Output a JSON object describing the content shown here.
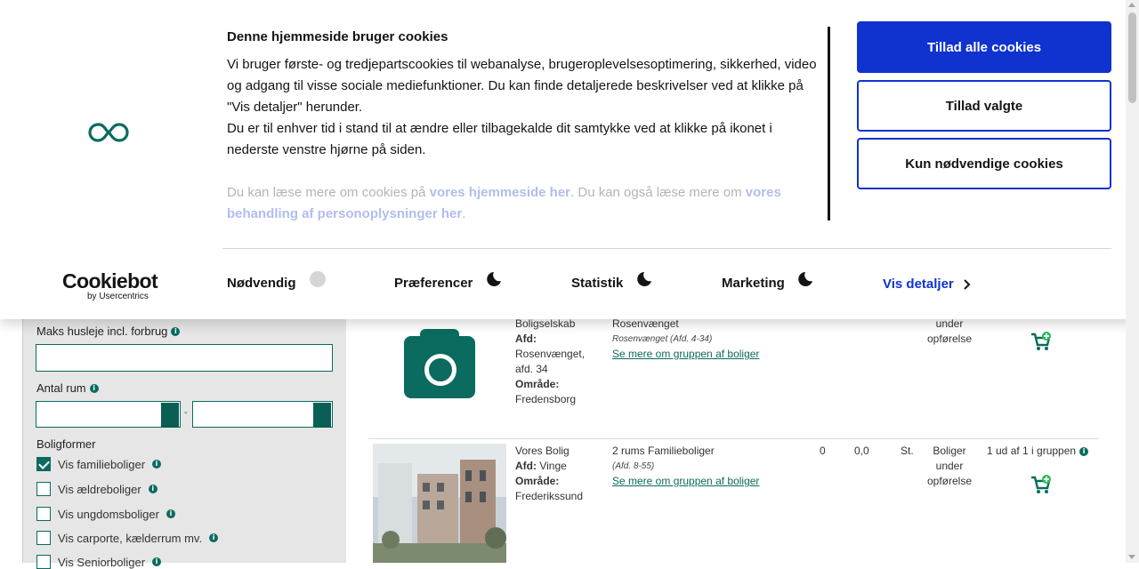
{
  "cookie_banner": {
    "title": "Denne hjemmeside bruger cookies",
    "text_1": "Vi bruger første- og tredjepartscookies til webanalyse, brugeroplevelsesoptimering, sikkerhed, video og adgang til visse sociale mediefunktioner. Du kan finde detaljerede beskrivelser ved at klikke på \"Vis detaljer\" herunder.",
    "text_2": "Du er til enhver tid i stand til at ændre eller tilbagekalde dit samtykke ved at klikke på ikonet i nederste venstre hjørne på siden.",
    "more_prefix": "Du kan læse mere om cookies på ",
    "more_link_1": "vores hjemmeside her",
    "more_middle": ". Du kan også læse mere om ",
    "more_link_2": "vores behandling af personoplysninger her",
    "more_suffix": ".",
    "buttons": {
      "allow_all": "Tillad alle cookies",
      "allow_selected": "Tillad valgte",
      "necessary_only": "Kun nødvendige cookies"
    },
    "brand": {
      "name": "Cookiebot",
      "sub": "by Usercentrics"
    },
    "categories": {
      "necessary": "Nødvendig",
      "preferences": "Præferencer",
      "statistics": "Statistik",
      "marketing": "Marketing"
    },
    "details_label": "Vis detaljer",
    "accent_color": "#1032cf"
  },
  "sidebar": {
    "max_rent_label": "Maks husleje incl. forbrug",
    "max_rent_value": "",
    "rooms_label": "Antal rum",
    "rooms_from": "",
    "rooms_to": "",
    "rooms_dash": "-",
    "housing_types_label": "Boligformer",
    "options": [
      {
        "label": "Vis familieboliger",
        "checked": true
      },
      {
        "label": "Vis ældreboliger",
        "checked": false
      },
      {
        "label": "Vis ungdomsboliger",
        "checked": false
      },
      {
        "label": "Vis carporte, kælderrum mv.",
        "checked": false
      },
      {
        "label": "Vis Seniorboliger",
        "checked": false
      }
    ]
  },
  "listings": [
    {
      "org": "Boligselskab",
      "afd_label": "Afd:",
      "afd_value": "Rosenvænget, afd. 34",
      "area_label": "Område:",
      "area_value": "Fredensborg",
      "group_title": "Rosenvænget",
      "group_sub": "Rosenvænget (Afd. 4-34)",
      "group_link": "Se mere om gruppen af boliger",
      "status": "under opførelse"
    },
    {
      "org": "Vores Bolig",
      "afd_label": "Afd:",
      "afd_value": "Vinge",
      "area_label": "Område:",
      "area_value": "Frederikssund",
      "group_title": "2 rums Familieboliger",
      "group_sub": "(Afd. 8-55)",
      "group_link": "Se mere om gruppen af boliger",
      "col_a": "0",
      "col_b": "0,0",
      "col_c": "St.",
      "status": "Boliger under opførelse",
      "availability": "1 ud af 1 i gruppen"
    }
  ],
  "colors": {
    "brand_green": "#0a6b5e"
  }
}
